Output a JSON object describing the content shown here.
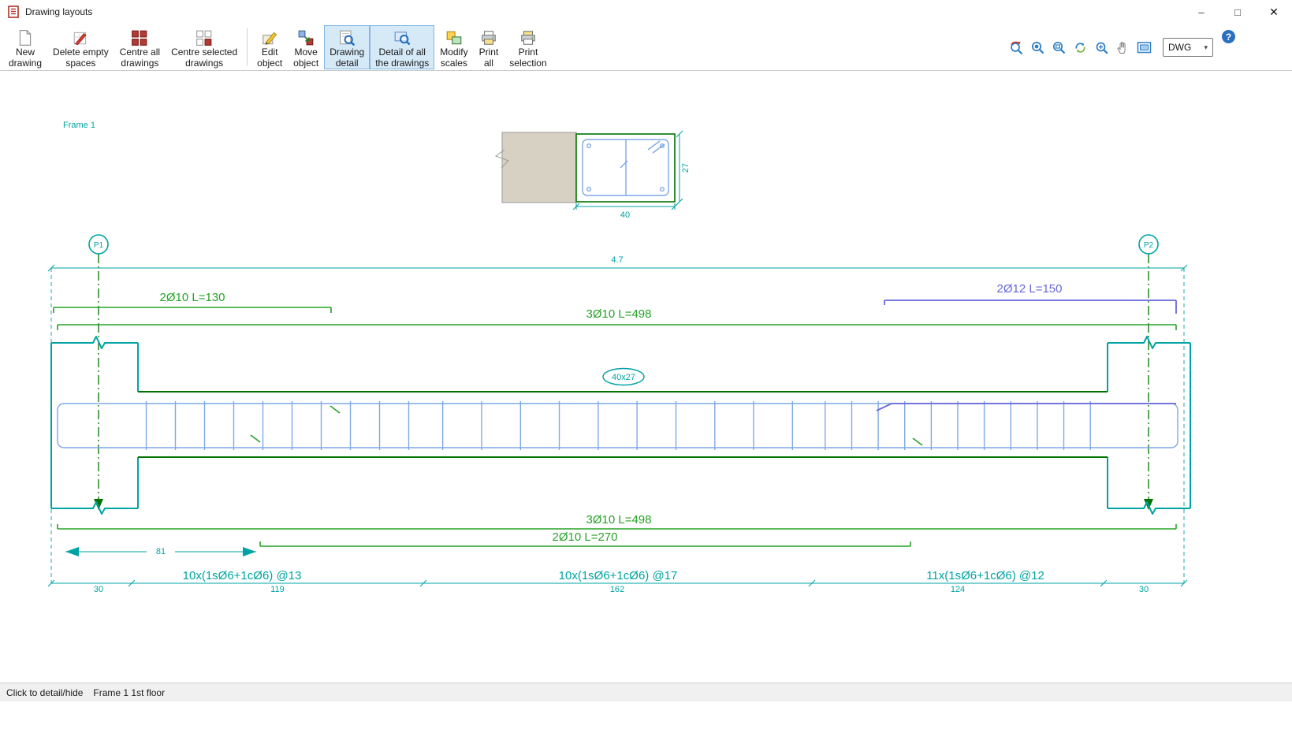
{
  "window": {
    "title": "Drawing layouts",
    "controls": {
      "minimize": "–",
      "maximize": "□",
      "close": "✕"
    }
  },
  "colors": {
    "teal": "#00A3A3",
    "dgreen": "#007300",
    "green": "#27A227",
    "purple": "#6868D8",
    "lblue": "#7FA8E8",
    "concrete": "#D6D1C3",
    "selbg": "#D5E9F7",
    "selbd": "#7FB5E3"
  },
  "toolbar": {
    "buttons": [
      {
        "id": "new-drawing",
        "icon": "new-drawing-icon",
        "line1": "New",
        "line2": "drawing",
        "selected": false
      },
      {
        "id": "delete-empty-spaces",
        "icon": "delete-empty-spaces-icon",
        "line1": "Delete empty",
        "line2": "spaces",
        "selected": false
      },
      {
        "id": "centre-all-drawings",
        "icon": "centre-all-drawings-icon",
        "line1": "Centre all",
        "line2": "drawings",
        "selected": false
      },
      {
        "id": "centre-selected-drawings",
        "icon": "centre-selected-drawings-icon",
        "line1": "Centre selected",
        "line2": "drawings",
        "selected": false
      },
      {
        "id": "edit-object",
        "icon": "edit-object-icon",
        "line1": "Edit",
        "line2": "object",
        "selected": false
      },
      {
        "id": "move-object",
        "icon": "move-object-icon",
        "line1": "Move",
        "line2": "object",
        "selected": false
      },
      {
        "id": "drawing-detail",
        "icon": "drawing-detail-icon",
        "line1": "Drawing",
        "line2": "detail",
        "selected": true
      },
      {
        "id": "detail-of-all-the-drawings",
        "icon": "detail-of-all-icon",
        "line1": "Detail of all",
        "line2": "the drawings",
        "selected": true
      },
      {
        "id": "modify-scales",
        "icon": "modify-scales-icon",
        "line1": "Modify",
        "line2": "scales",
        "selected": false
      },
      {
        "id": "print-all",
        "icon": "print-all-icon",
        "line1": "Print",
        "line2": "all",
        "selected": false
      },
      {
        "id": "print-selection",
        "icon": "print-selection-icon",
        "line1": "Print",
        "line2": "selection",
        "selected": false
      }
    ],
    "view_icons": [
      {
        "id": "zoom-previous"
      },
      {
        "id": "zoom-extents"
      },
      {
        "id": "zoom-window"
      },
      {
        "id": "redraw"
      },
      {
        "id": "zoom-realtime"
      },
      {
        "id": "pan"
      },
      {
        "id": "full-window"
      }
    ],
    "format_dropdown": "DWG",
    "help_label": "?"
  },
  "statusbar": {
    "hint": "Click to detail/hide",
    "context": "Frame 1 1st floor"
  },
  "drawing": {
    "frame_label": "Frame 1",
    "section": {
      "width": "40",
      "height": "27"
    },
    "supports": [
      {
        "label": "P1"
      },
      {
        "label": "P2"
      }
    ],
    "span_total": "4.7",
    "beam_size": "40x27",
    "top_bars": [
      {
        "label": "2Ø10  L=130",
        "color": "green"
      },
      {
        "label": "2Ø12  L=150",
        "color": "purple"
      },
      {
        "label": "3Ø10  L=498",
        "color": "green"
      }
    ],
    "bottom_bars": [
      {
        "label": "3Ø10  L=498",
        "color": "green"
      },
      {
        "label": "2Ø10  L=270",
        "color": "green"
      }
    ],
    "anchorage": "81",
    "stirrup_zones": [
      {
        "label": "10x(1sØ6+1cØ6) @13",
        "length": "119",
        "count": 10
      },
      {
        "label": "10x(1sØ6+1cØ6) @17",
        "length": "162",
        "count": 10
      },
      {
        "label": "11x(1sØ6+1cØ6) @12",
        "length": "124",
        "count": 11
      }
    ],
    "end_dims": [
      "30",
      "30"
    ]
  }
}
